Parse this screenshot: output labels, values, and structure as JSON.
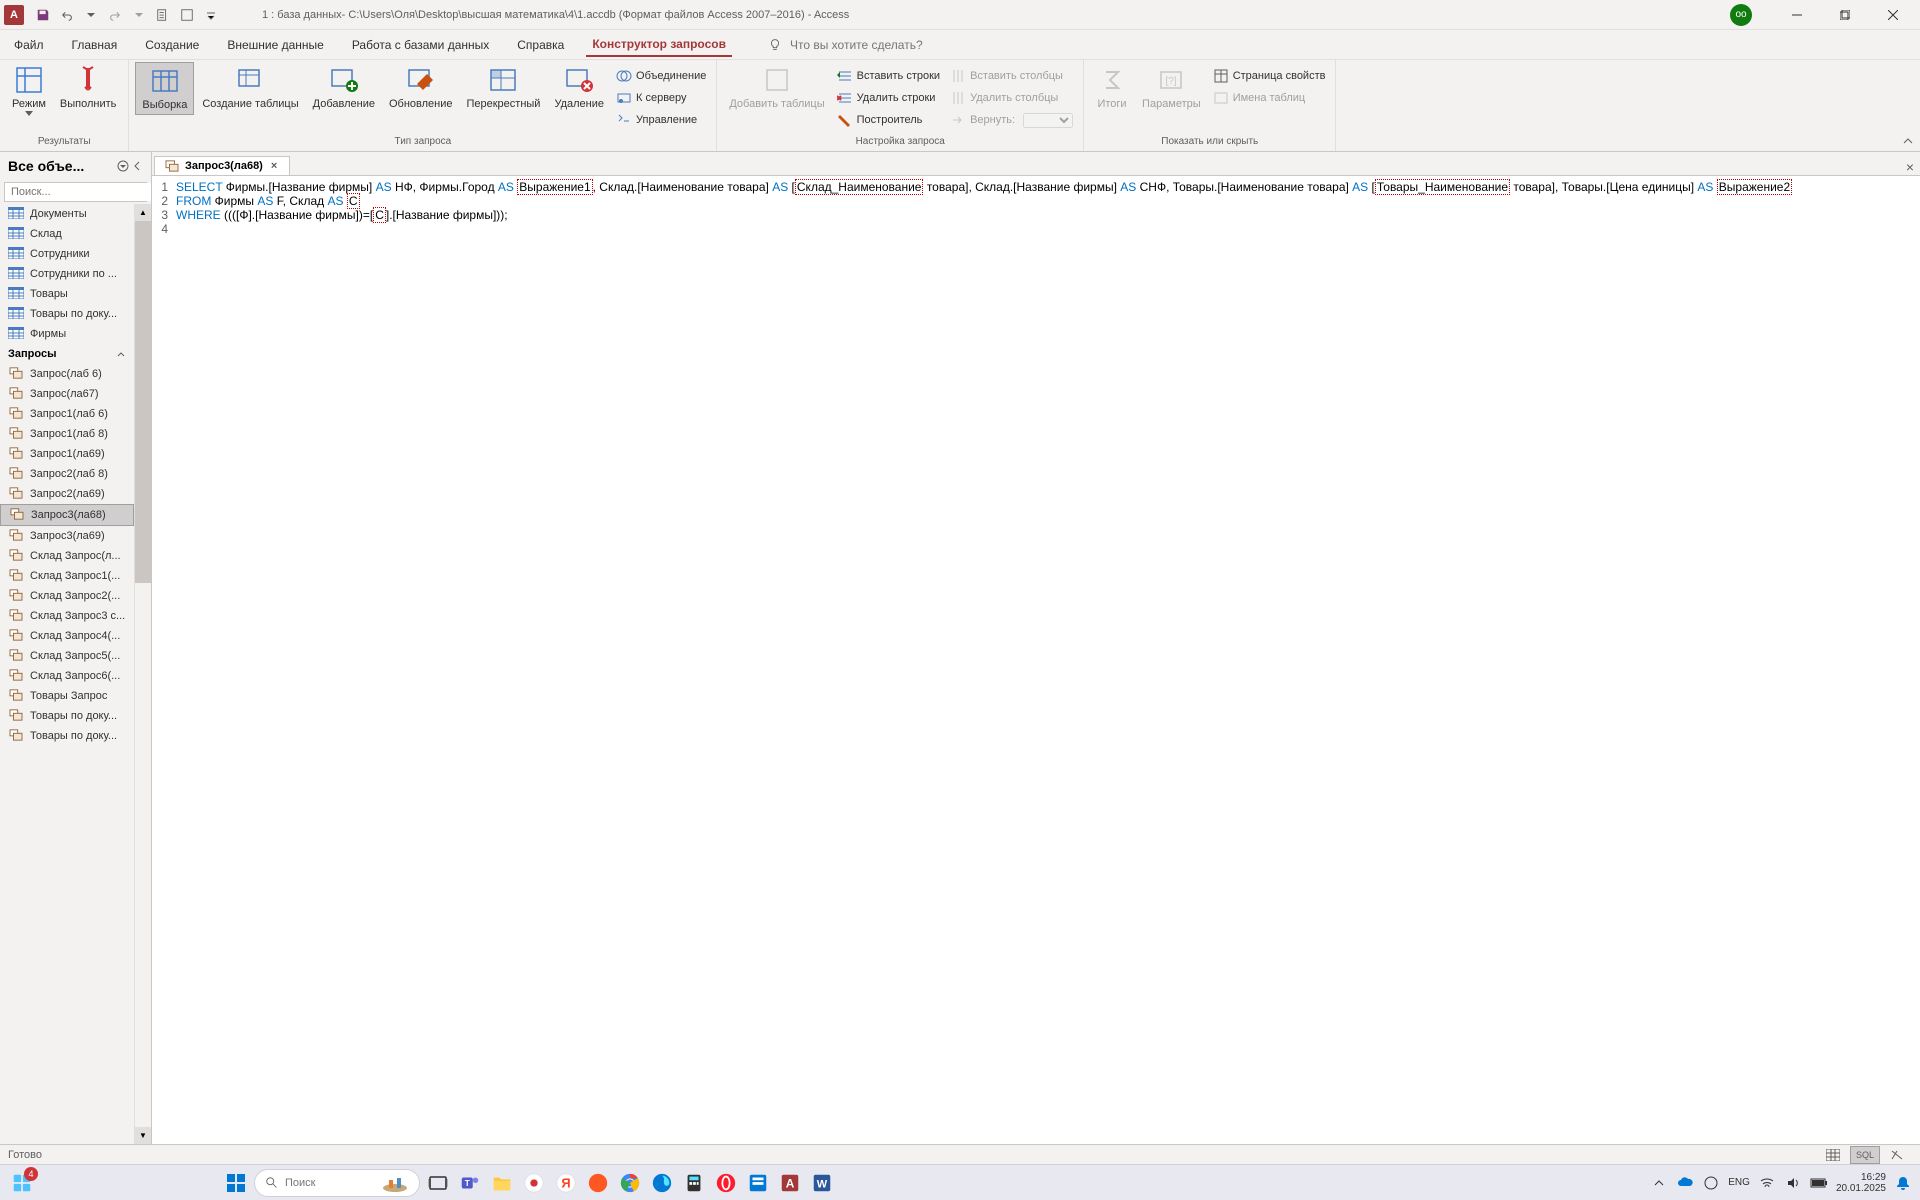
{
  "titlebar": {
    "title": "1 : база данных- C:\\Users\\Оля\\Desktop\\высшая математика\\4\\1.accdb  (Формат файлов Access 2007–2016)  -  Access",
    "account": "оо"
  },
  "tabs": {
    "file": "Файл",
    "home": "Главная",
    "create": "Создание",
    "external": "Внешние данные",
    "db_tools": "Работа с базами данных",
    "help": "Справка",
    "design": "Конструктор запросов",
    "tellme_placeholder": "Что вы хотите сделать?"
  },
  "ribbon": {
    "results": {
      "view": "Режим",
      "run": "Выполнить",
      "group": "Результаты"
    },
    "querytype": {
      "select": "Выборка",
      "maketable": "Создание таблицы",
      "append": "Добавление",
      "update": "Обновление",
      "crosstab": "Перекрестный",
      "delete": "Удаление",
      "union": "Объединение",
      "passthrough": "К серверу",
      "datadef": "Управление",
      "group": "Тип запроса"
    },
    "setup": {
      "addtables": "Добавить таблицы",
      "insertrows": "Вставить строки",
      "deleterows": "Удалить строки",
      "builder": "Построитель",
      "insertcols": "Вставить столбцы",
      "deletecols": "Удалить столбцы",
      "return": "Вернуть:",
      "group": "Настройка запроса"
    },
    "showhide": {
      "totals": "Итоги",
      "params": "Параметры",
      "propsheet": "Страница свойств",
      "tablenames": "Имена таблиц",
      "group": "Показать или скрыть"
    }
  },
  "navpane": {
    "title": "Все объе...",
    "search_placeholder": "Поиск...",
    "category_queries": "Запросы",
    "tables": [
      "Документы",
      "Склад",
      "Сотрудники",
      "Сотрудники по ...",
      "Товары",
      "Товары по доку...",
      "Фирмы"
    ],
    "queries": [
      "Запрос(лаб 6)",
      "Запрос(ла67)",
      "Запрос1(лаб 6)",
      "Запрос1(лаб 8)",
      "Запрос1(ла69)",
      "Запрос2(лаб 8)",
      "Запрос2(ла69)",
      "Запрос3(ла68)",
      "Запрос3(ла69)",
      "Склад Запрос(л...",
      "Склад Запрос1(...",
      "Склад Запрос2(...",
      "Склад Запрос3 с...",
      "Склад Запрос4(...",
      "Склад Запрос5(...",
      "Склад Запрос6(...",
      "Товары Запрос",
      "Товары по доку...",
      "Товары по доку..."
    ],
    "selected_query": "Запрос3(ла68)"
  },
  "document": {
    "tab_title": "Запрос3(ла68)",
    "sql": {
      "line1_kw1": "SELECT",
      "line1_p1": " Фирмы.[Название фирмы] ",
      "line1_as1": "AS",
      "line1_p2": " НФ, Фирмы.Город ",
      "line1_as2": "AS",
      "line1_sq1": "Выражение1",
      "line1_p3": ", Склад.[Наименование товара] ",
      "line1_as3": "AS",
      "line1_p4": " [",
      "line1_sq2": "Склад_Наименование",
      "line1_p5": " товара], Склад.[Название фирмы] ",
      "line1_as4": "AS",
      "line1_p6": " СНФ, Товары.[Наименование товара] ",
      "line1_as5": "AS",
      "line1b_p1": "[",
      "line1b_sq1": "Товары_Наименование",
      "line1b_p2": " товара], Товары.[Цена единицы] ",
      "line1b_as1": "AS",
      "line1b_sq2": "Выражение2",
      "line2_kw": "FROM",
      "line2_p1": " Фирмы ",
      "line2_as1": "AS",
      "line2_p2": " F, Склад ",
      "line2_as2": "AS",
      "line2_sq": "C",
      "line3_kw": "WHERE",
      "line3_p1": " ((([Ф].[Название фирмы])=[",
      "line3_sq": "С",
      "line3_p2": "].[Название фирмы]));"
    }
  },
  "statusbar": {
    "ready": "Готово",
    "sql_label": "SQL"
  },
  "taskbar": {
    "search_placeholder": "Поиск",
    "lang": "ENG",
    "time": "16:29",
    "date": "20.01.2025",
    "notif_count": "4"
  }
}
